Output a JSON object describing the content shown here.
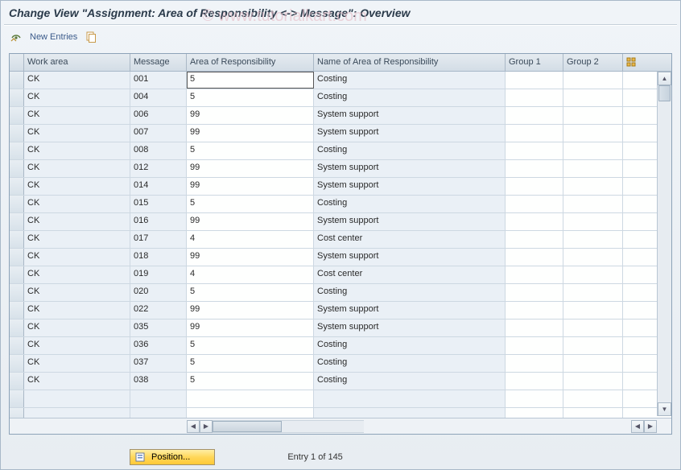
{
  "watermark": "© www.tutorialkart.com",
  "title": "Change View \"Assignment: Area of Responsibility <-> Message\": Overview",
  "toolbar": {
    "new_entries_label": "New Entries"
  },
  "table": {
    "headers": {
      "work_area": "Work area",
      "message": "Message",
      "area": "Area of Responsibility",
      "name": "Name of Area of Responsibility",
      "group1": "Group 1",
      "group2": "Group 2"
    },
    "rows": [
      {
        "work_area": "CK",
        "message": "001",
        "area": "5",
        "name": "Costing",
        "g1": "",
        "g2": ""
      },
      {
        "work_area": "CK",
        "message": "004",
        "area": "5",
        "name": "Costing",
        "g1": "",
        "g2": ""
      },
      {
        "work_area": "CK",
        "message": "006",
        "area": "99",
        "name": "System support",
        "g1": "",
        "g2": ""
      },
      {
        "work_area": "CK",
        "message": "007",
        "area": "99",
        "name": "System support",
        "g1": "",
        "g2": ""
      },
      {
        "work_area": "CK",
        "message": "008",
        "area": "5",
        "name": "Costing",
        "g1": "",
        "g2": ""
      },
      {
        "work_area": "CK",
        "message": "012",
        "area": "99",
        "name": "System support",
        "g1": "",
        "g2": ""
      },
      {
        "work_area": "CK",
        "message": "014",
        "area": "99",
        "name": "System support",
        "g1": "",
        "g2": ""
      },
      {
        "work_area": "CK",
        "message": "015",
        "area": "5",
        "name": "Costing",
        "g1": "",
        "g2": ""
      },
      {
        "work_area": "CK",
        "message": "016",
        "area": "99",
        "name": "System support",
        "g1": "",
        "g2": ""
      },
      {
        "work_area": "CK",
        "message": "017",
        "area": "4",
        "name": "Cost center",
        "g1": "",
        "g2": ""
      },
      {
        "work_area": "CK",
        "message": "018",
        "area": "99",
        "name": "System support",
        "g1": "",
        "g2": ""
      },
      {
        "work_area": "CK",
        "message": "019",
        "area": "4",
        "name": "Cost center",
        "g1": "",
        "g2": ""
      },
      {
        "work_area": "CK",
        "message": "020",
        "area": "5",
        "name": "Costing",
        "g1": "",
        "g2": ""
      },
      {
        "work_area": "CK",
        "message": "022",
        "area": "99",
        "name": "System support",
        "g1": "",
        "g2": ""
      },
      {
        "work_area": "CK",
        "message": "035",
        "area": "99",
        "name": "System support",
        "g1": "",
        "g2": ""
      },
      {
        "work_area": "CK",
        "message": "036",
        "area": "5",
        "name": "Costing",
        "g1": "",
        "g2": ""
      },
      {
        "work_area": "CK",
        "message": "037",
        "area": "5",
        "name": "Costing",
        "g1": "",
        "g2": ""
      },
      {
        "work_area": "CK",
        "message": "038",
        "area": "5",
        "name": "Costing",
        "g1": "",
        "g2": ""
      },
      {
        "work_area": "",
        "message": "",
        "area": "",
        "name": "",
        "g1": "",
        "g2": ""
      },
      {
        "work_area": "",
        "message": "",
        "area": "",
        "name": "",
        "g1": "",
        "g2": ""
      }
    ]
  },
  "footer": {
    "position_button": "Position...",
    "entry_text": "Entry 1 of 145"
  }
}
